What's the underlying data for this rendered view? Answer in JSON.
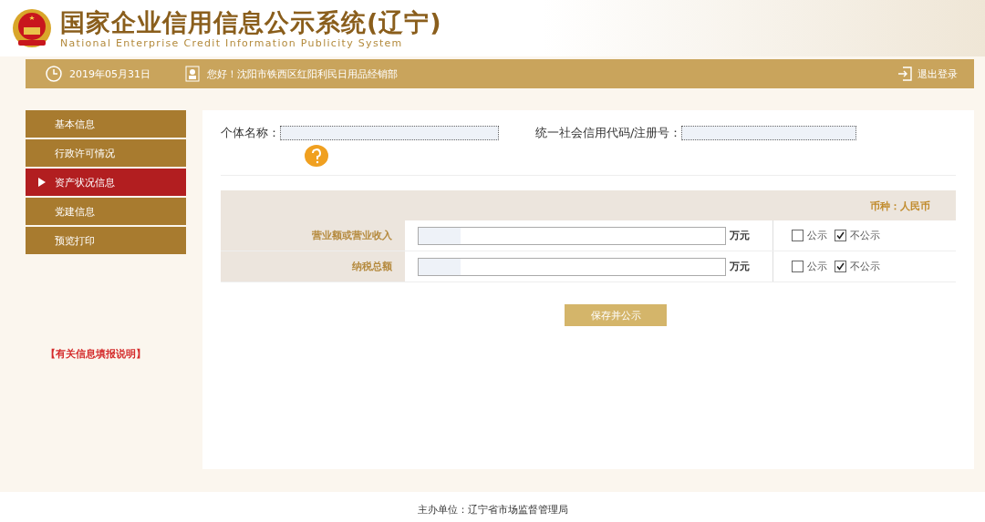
{
  "header": {
    "title": "国家企业信用信息公示系统(辽宁)",
    "subtitle": "National Enterprise Credit Information Publicity System"
  },
  "top_bar": {
    "date": "2019年05月31日",
    "greeting": "您好！沈阳市铁西区红阳利民日用品经销部",
    "logout": "退出登录"
  },
  "sidebar": {
    "items": [
      {
        "label": "基本信息",
        "selected": false
      },
      {
        "label": "行政许可情况",
        "selected": false
      },
      {
        "label": "资产状况信息",
        "selected": true
      },
      {
        "label": "党建信息",
        "selected": false
      },
      {
        "label": "预览打印",
        "selected": false
      }
    ],
    "help_link": "【有关信息填报说明】"
  },
  "form": {
    "name_label": "个体名称：",
    "code_label": "统一社会信用代码/注册号：",
    "currency": "币种：人民币",
    "rows": [
      {
        "label": "营业额或营业收入",
        "unit": "万元",
        "options": [
          {
            "label": "公示",
            "checked": false
          },
          {
            "label": "不公示",
            "checked": true
          }
        ]
      },
      {
        "label": "纳税总额",
        "unit": "万元",
        "options": [
          {
            "label": "公示",
            "checked": false
          },
          {
            "label": "不公示",
            "checked": true
          }
        ]
      }
    ],
    "save_button": "保存并公示"
  },
  "footer": {
    "organizer": "主办单位：辽宁省市场监督管理局"
  }
}
